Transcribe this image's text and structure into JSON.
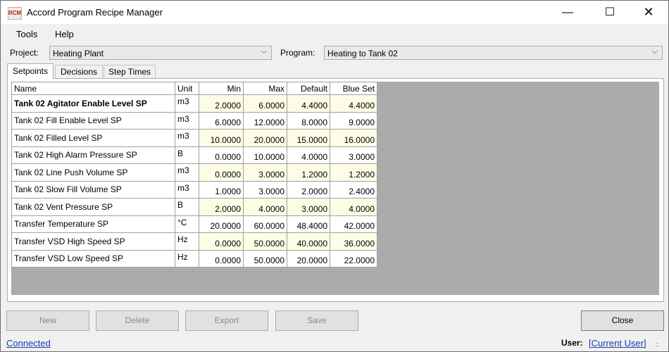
{
  "window": {
    "title": "Accord Program Recipe Manager",
    "icon_text": "RCM",
    "controls": {
      "minimize": "—",
      "maximize": "☐",
      "close": "✕"
    }
  },
  "menu": {
    "tools": "Tools",
    "help": "Help"
  },
  "selectors": {
    "project_label": "Project:",
    "project_value": "Heating Plant",
    "program_label": "Program:",
    "program_value": "Heating to Tank 02",
    "dropdown_glyph": "⌵"
  },
  "tabs": [
    {
      "label": "Setpoints",
      "active": true
    },
    {
      "label": "Decisions",
      "active": false
    },
    {
      "label": "Step Times",
      "active": false
    }
  ],
  "grid": {
    "headers": {
      "name": "Name",
      "unit": "Unit",
      "min": "Min",
      "max": "Max",
      "default": "Default",
      "blue_set": "Blue Set"
    },
    "rows": [
      {
        "name": "Tank 02 Agitator Enable Level SP",
        "unit": "m3",
        "min": "2.0000",
        "max": "6.0000",
        "default": "4.4000",
        "blue_set": "4.4000"
      },
      {
        "name": "Tank 02 Fill Enable Level SP",
        "unit": "m3",
        "min": "6.0000",
        "max": "12.0000",
        "default": "8.0000",
        "blue_set": "9.0000"
      },
      {
        "name": "Tank 02 Filled Level SP",
        "unit": "m3",
        "min": "10.0000",
        "max": "20.0000",
        "default": "15.0000",
        "blue_set": "16.0000"
      },
      {
        "name": "Tank 02 High Alarm Pressure SP",
        "unit": "B",
        "min": "0.0000",
        "max": "10.0000",
        "default": "4.0000",
        "blue_set": "3.0000"
      },
      {
        "name": "Tank 02 Line Push Volume SP",
        "unit": "m3",
        "min": "0.0000",
        "max": "3.0000",
        "default": "1.2000",
        "blue_set": "1.2000"
      },
      {
        "name": "Tank 02 Slow Fill Volume SP",
        "unit": "m3",
        "min": "1.0000",
        "max": "3.0000",
        "default": "2.0000",
        "blue_set": "2.4000"
      },
      {
        "name": "Tank 02 Vent Pressure SP",
        "unit": "B",
        "min": "2.0000",
        "max": "4.0000",
        "default": "3.0000",
        "blue_set": "4.0000"
      },
      {
        "name": "Transfer Temperature SP",
        "unit": "°C",
        "min": "20.0000",
        "max": "60.0000",
        "default": "48.4000",
        "blue_set": "42.0000"
      },
      {
        "name": "Transfer VSD High Speed SP",
        "unit": "Hz",
        "min": "0.0000",
        "max": "50.0000",
        "default": "40.0000",
        "blue_set": "36.0000"
      },
      {
        "name": "Transfer VSD Low Speed SP",
        "unit": "Hz",
        "min": "0.0000",
        "max": "50.0000",
        "default": "20.0000",
        "blue_set": "22.0000"
      }
    ]
  },
  "buttons": {
    "new": "New",
    "delete": "Delete",
    "export": "Export",
    "save": "Save",
    "close": "Close"
  },
  "status": {
    "connection": "Connected",
    "user_label": "User:",
    "user_value": "[Current User]",
    "grip": ".::"
  }
}
